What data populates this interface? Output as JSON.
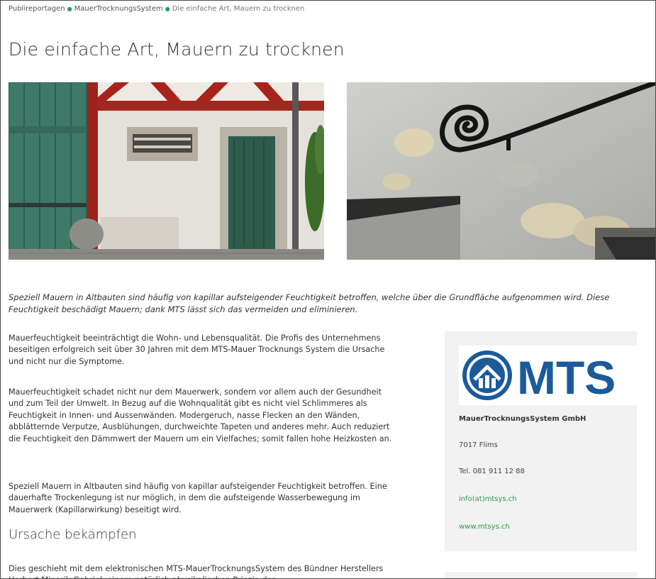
{
  "breadcrumb": {
    "items": [
      "Publireportagen",
      "MauerTrocknungsSystem"
    ],
    "current": "Die einfache Art, Mauern zu trocknen"
  },
  "article": {
    "title": "Die einfache Art, Mauern zu trocknen",
    "lead": "Speziell Mauern in Altbauten sind häufig von kapillar aufsteigender Feuchtigkeit betroffen, welche über die Grundfläche aufgenommen wird. Diese Feuchtigkeit beschädigt Mauern; dank MTS lässt sich das vermeiden und eliminieren.",
    "paragraphs": [
      "Mauerfeuchtigkeit beeinträchtigt die Wohn- und Lebensqualität. Die Profis des Unternehmens beseitigen erfolgreich seit über 30 Jahren mit dem MTS-Mauer Trocknungs System die Ursache und nicht nur die Symptome.",
      "Mauerfeuchtigkeit schadet nicht nur dem Mauerwerk, sondern vor allem auch der Gesundheit und zum Teil der Umwelt. In Bezug auf die Wohnqualität gibt es nicht viel Schlimmeres als Feuchtigkeit in Innen- und Aussenwänden. Modergeruch, nasse Flecken an den Wänden, abblätternde Verputze, Ausblühungen, durchweichte Tapeten und anderes mehr. Auch reduziert die Feuchtigkeit den Dämmwert der Mauern um ein Vielfaches; somit fallen hohe Heizkosten an.",
      "Speziell Mauern in Altbauten sind häufig von kapillar aufsteigender Feuchtigkeit betroffen. Eine dauerhafte Trockenlegung ist nur möglich, in dem die aufsteigende Wasserbewegung im Mauerwerk (Kapillarwirkung) beseitigt wird."
    ],
    "subheading": "Ursache bekämpfen",
    "paragraph4": "Dies geschieht mit dem elektronischen MTS-MauerTrocknungsSystem des Bündner Herstellers Herbert Minarik-Gabriel, einem natürlich physikalischen Prinzip der"
  },
  "sidebar": {
    "logo_text": "MTS",
    "company": "MauerTrocknungsSystem GmbH",
    "zip_city": "7017 Flims",
    "phone": "Tel. 081 911 12 88",
    "email": "info(at)mtsys.ch",
    "website": "www.mtsys.ch"
  },
  "colors": {
    "link_green": "#2a9a4a",
    "logo_blue": "#1b5a9b",
    "card_bg": "#f2f2f2"
  }
}
